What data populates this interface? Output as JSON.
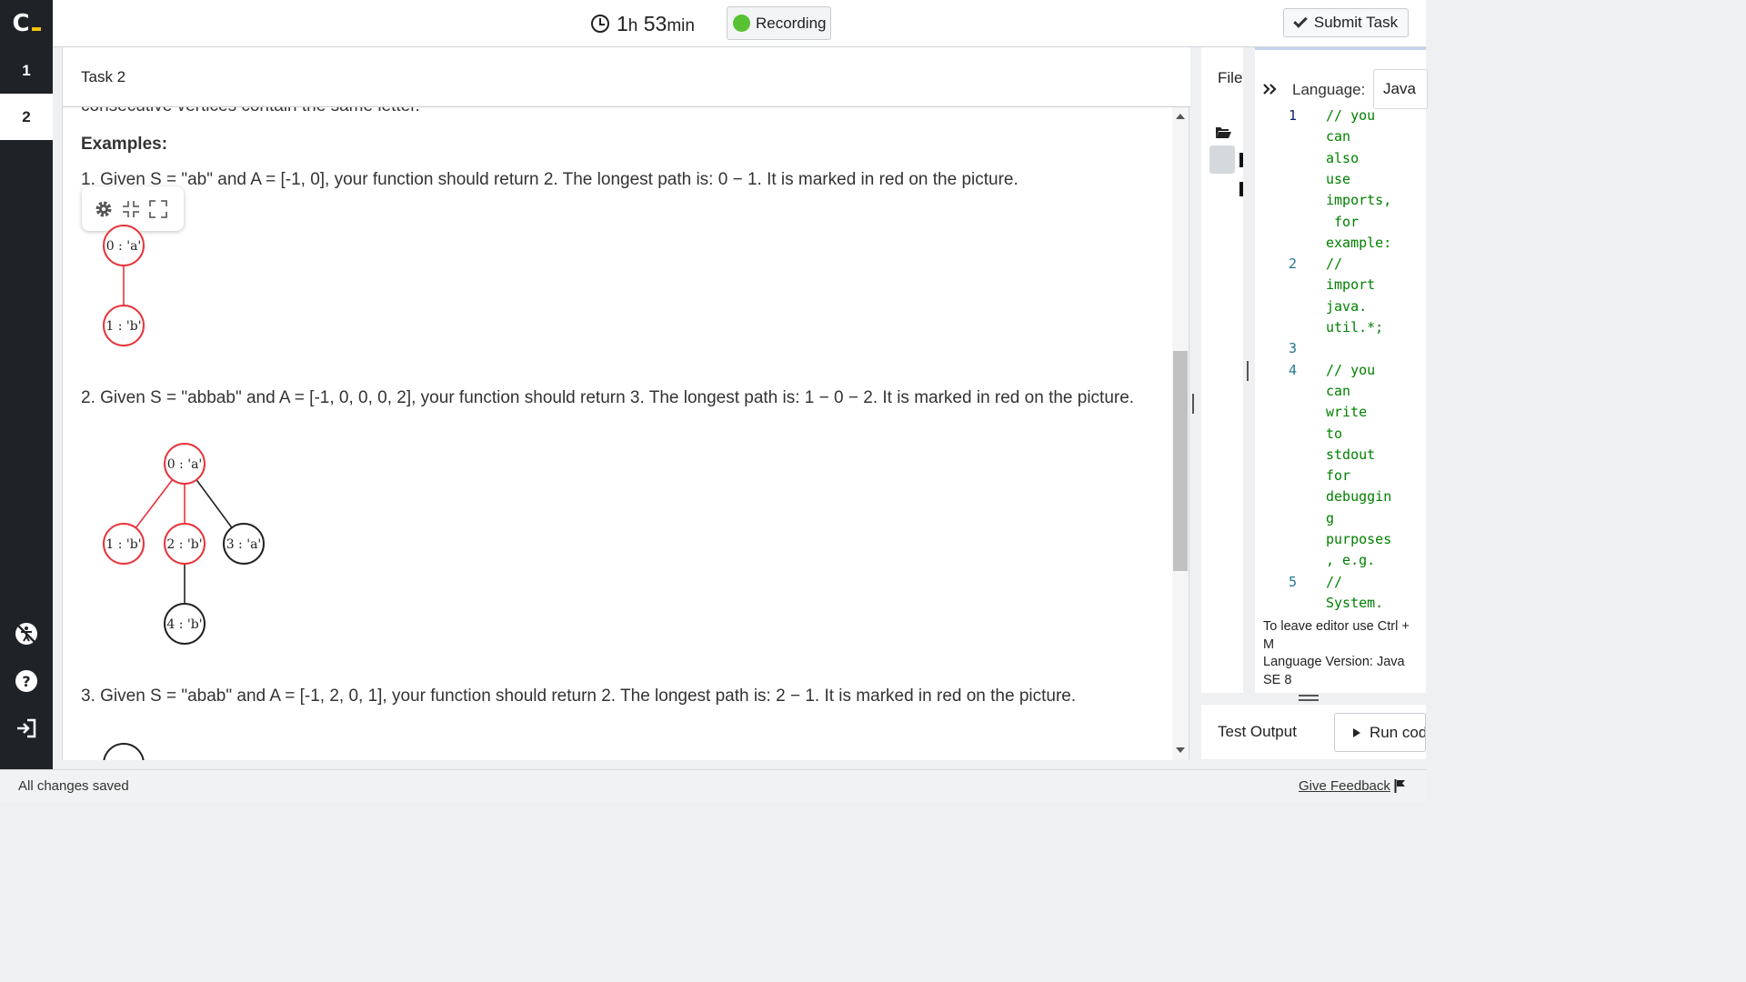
{
  "header": {
    "timer_hours": "1",
    "timer_h_unit": "h",
    "timer_minutes": "53",
    "timer_min_unit": "min",
    "recording_label": "Recording",
    "submit_label": "Submit Task"
  },
  "sidebar": {
    "tasks": [
      "1",
      "2"
    ]
  },
  "task": {
    "title": "Task 2",
    "cut_text": "consecutive vertices contain the same letter.",
    "examples_heading": "Examples:",
    "example1": "1. Given S = \"ab\" and A = [-1, 0], your function should return 2. The longest path is: 0 − 1. It is marked in red on the picture.",
    "example2": "2. Given S = \"abbab\" and A = [-1, 0, 0, 0, 2], your function should return 3. The longest path is: 1 − 0 − 2. It is marked in red on the picture.",
    "example3": "3. Given S = \"abab\" and A = [-1, 2, 0, 1], your function should return 2. The longest path is: 2 − 1. It is marked in red on the picture.",
    "graph1": {
      "nodes": [
        "0 : 'a'",
        "1 : 'b'"
      ]
    },
    "graph2": {
      "nodes": [
        "0 : 'a'",
        "1 : 'b'",
        "2 : 'b'",
        "3 : 'a'",
        "4 : 'b'"
      ]
    }
  },
  "files": {
    "label": "File"
  },
  "editor": {
    "language_label": "Language:",
    "language_value": "Java",
    "lines": [
      {
        "n": "1",
        "t": "// you"
      },
      {
        "n": "",
        "t": "can"
      },
      {
        "n": "",
        "t": "also"
      },
      {
        "n": "",
        "t": "use"
      },
      {
        "n": "",
        "t": "imports,"
      },
      {
        "n": "",
        "t": " for"
      },
      {
        "n": "",
        "t": "example:"
      },
      {
        "n": "2",
        "t": "//"
      },
      {
        "n": "",
        "t": "import"
      },
      {
        "n": "",
        "t": "java."
      },
      {
        "n": "",
        "t": "util.*;"
      },
      {
        "n": "3",
        "t": ""
      },
      {
        "n": "4",
        "t": "// you"
      },
      {
        "n": "",
        "t": "can"
      },
      {
        "n": "",
        "t": "write"
      },
      {
        "n": "",
        "t": "to"
      },
      {
        "n": "",
        "t": "stdout"
      },
      {
        "n": "",
        "t": "for"
      },
      {
        "n": "",
        "t": "debuggin"
      },
      {
        "n": "",
        "t": "g"
      },
      {
        "n": "",
        "t": "purposes"
      },
      {
        "n": "",
        "t": ", e.g."
      },
      {
        "n": "5",
        "t": "//"
      },
      {
        "n": "",
        "t": "System."
      }
    ],
    "help_line1": "To leave editor use Ctrl + M",
    "help_line2": "Language Version: Java SE 8"
  },
  "test": {
    "label": "Test Output",
    "run_label": "Run code"
  },
  "status": {
    "saved": "All changes saved",
    "feedback": "Give Feedback"
  },
  "colors": {
    "sidebar_bg": "#1f2328",
    "accent_yellow": "#f2c200",
    "recording_green": "#59c134",
    "path_red": "#e8333a",
    "code_comment": "#008000",
    "line_number": "#237893"
  }
}
